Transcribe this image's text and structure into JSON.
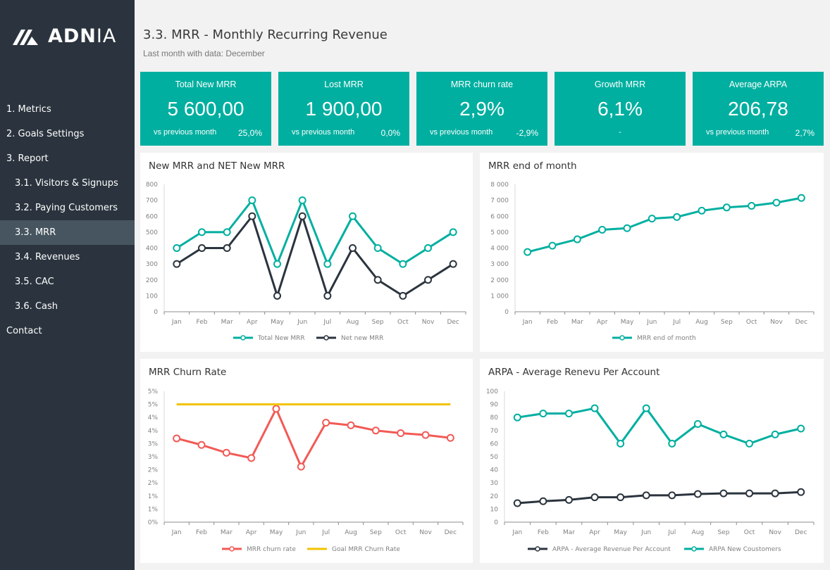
{
  "brand": {
    "logo_text_bold": "ADN",
    "logo_text_thin": "IA"
  },
  "sidebar": {
    "items": [
      {
        "label": "1. Metrics",
        "level": 0,
        "active": false
      },
      {
        "label": "2. Goals Settings",
        "level": 0,
        "active": false
      },
      {
        "label": "3. Report",
        "level": 0,
        "active": false
      },
      {
        "label": "3.1. Visitors & Signups",
        "level": 1,
        "active": false
      },
      {
        "label": "3.2. Paying Customers",
        "level": 1,
        "active": false
      },
      {
        "label": "3.3. MRR",
        "level": 1,
        "active": true
      },
      {
        "label": "3.4. Revenues",
        "level": 1,
        "active": false
      },
      {
        "label": "3.5. CAC",
        "level": 1,
        "active": false
      },
      {
        "label": "3.6. Cash",
        "level": 1,
        "active": false
      },
      {
        "label": "Contact",
        "level": 0,
        "active": false
      }
    ]
  },
  "header": {
    "title": "3.3. MRR - Monthly Recurring Revenue",
    "subtitle": "Last month with data:  December"
  },
  "colors": {
    "teal": "#00afa0",
    "dark": "#2b343e",
    "red": "#f25a55",
    "gold": "#f2c200"
  },
  "kpis": [
    {
      "title": "Total New MRR",
      "value": "5 600,00",
      "vs_label": "vs previous month",
      "delta": "25,0%"
    },
    {
      "title": "Lost MRR",
      "value": "1 900,00",
      "vs_label": "vs previous month",
      "delta": "0,0%"
    },
    {
      "title": "MRR churn rate",
      "value": "2,9%",
      "vs_label": "vs previous month",
      "delta": "-2,9%"
    },
    {
      "title": "Growth MRR",
      "value": "6,1%",
      "vs_label": "",
      "delta": "-"
    },
    {
      "title": "Average ARPA",
      "value": "206,78",
      "vs_label": "vs previous month",
      "delta": "2,7%"
    }
  ],
  "chart_data": [
    {
      "type": "line",
      "title": "New MRR and NET New MRR",
      "categories": [
        "Jan",
        "Feb",
        "Mar",
        "Apr",
        "May",
        "Jun",
        "Jul",
        "Aug",
        "Sep",
        "Oct",
        "Nov",
        "Dec"
      ],
      "ylim": [
        0,
        800
      ],
      "yticks": [
        0,
        100,
        200,
        300,
        400,
        500,
        600,
        700,
        800
      ],
      "ytick_labels": [
        "0",
        "100",
        "200",
        "300",
        "400",
        "500",
        "600",
        "700",
        "800"
      ],
      "legend": "bottom",
      "series": [
        {
          "name": "Total New MRR",
          "color": "#00afa0",
          "values": [
            400,
            500,
            500,
            700,
            300,
            700,
            300,
            600,
            400,
            300,
            400,
            500
          ]
        },
        {
          "name": "Net new MRR",
          "color": "#2b343e",
          "values": [
            300,
            400,
            400,
            600,
            100,
            600,
            100,
            400,
            200,
            100,
            200,
            300
          ]
        }
      ]
    },
    {
      "type": "line",
      "title": "MRR end of month",
      "categories": [
        "Jan",
        "Feb",
        "Mar",
        "Apr",
        "May",
        "Jun",
        "Jul",
        "Aug",
        "Sep",
        "Oct",
        "Nov",
        "Dec"
      ],
      "ylim": [
        0,
        8000
      ],
      "yticks": [
        0,
        1000,
        2000,
        3000,
        4000,
        5000,
        6000,
        7000,
        8000
      ],
      "ytick_labels": [
        "0",
        "1 000",
        "2 000",
        "3 000",
        "4 000",
        "5 000",
        "6 000",
        "7 000",
        "8 000"
      ],
      "legend": "bottom",
      "series": [
        {
          "name": "MRR end of month",
          "color": "#00afa0",
          "values": [
            3750,
            4150,
            4550,
            5150,
            5250,
            5850,
            5950,
            6350,
            6550,
            6650,
            6850,
            7150
          ]
        }
      ]
    },
    {
      "type": "line",
      "title": "MRR Churn Rate",
      "categories": [
        "Jan",
        "Feb",
        "Mar",
        "Apr",
        "May",
        "Jun",
        "Jul",
        "Aug",
        "Sep",
        "Oct",
        "Nov",
        "Dec"
      ],
      "ylim": [
        0,
        5
      ],
      "yticks": [
        0,
        0.5,
        1,
        1.5,
        2,
        2.5,
        3,
        3.5,
        4,
        4.5,
        5
      ],
      "ytick_labels": [
        "0%",
        "1%",
        "1%",
        "2%",
        "2%",
        "3%",
        "3%",
        "4%",
        "4%",
        "5%",
        "5%"
      ],
      "legend": "bottom",
      "series": [
        {
          "name": "MRR churn rate",
          "color": "#f25a55",
          "markers": true,
          "values": [
            3.2,
            2.95,
            2.65,
            2.45,
            4.33,
            2.12,
            3.8,
            3.7,
            3.5,
            3.4,
            3.33,
            3.22
          ]
        },
        {
          "name": "Goal MRR Churn Rate",
          "color": "#f2c200",
          "markers": false,
          "values": [
            4.5,
            4.5,
            4.5,
            4.5,
            4.5,
            4.5,
            4.5,
            4.5,
            4.5,
            4.5,
            4.5,
            4.5
          ]
        }
      ]
    },
    {
      "type": "line",
      "title": "ARPA - Average Renevu Per Account",
      "categories": [
        "Jan",
        "Feb",
        "Mar",
        "Apr",
        "May",
        "Jun",
        "Jul",
        "Aug",
        "Sep",
        "Oct",
        "Nov",
        "Dec"
      ],
      "ylim": [
        0,
        100
      ],
      "yticks": [
        0,
        10,
        20,
        30,
        40,
        50,
        60,
        70,
        80,
        90,
        100
      ],
      "ytick_labels": [
        "0",
        "10",
        "20",
        "30",
        "40",
        "50",
        "60",
        "70",
        "80",
        "90",
        "100"
      ],
      "legend": "bottom",
      "series": [
        {
          "name": "ARPA - Average Revenue Per Account",
          "color": "#2b343e",
          "values": [
            14.5,
            16,
            17,
            19,
            19,
            20.5,
            20.5,
            21.5,
            22,
            22,
            22,
            23
          ]
        },
        {
          "name": "ARPA New Coustomers",
          "color": "#00afa0",
          "values": [
            80,
            83,
            83,
            87,
            60,
            87,
            60,
            75,
            67,
            60,
            67,
            71.5
          ]
        }
      ]
    }
  ]
}
